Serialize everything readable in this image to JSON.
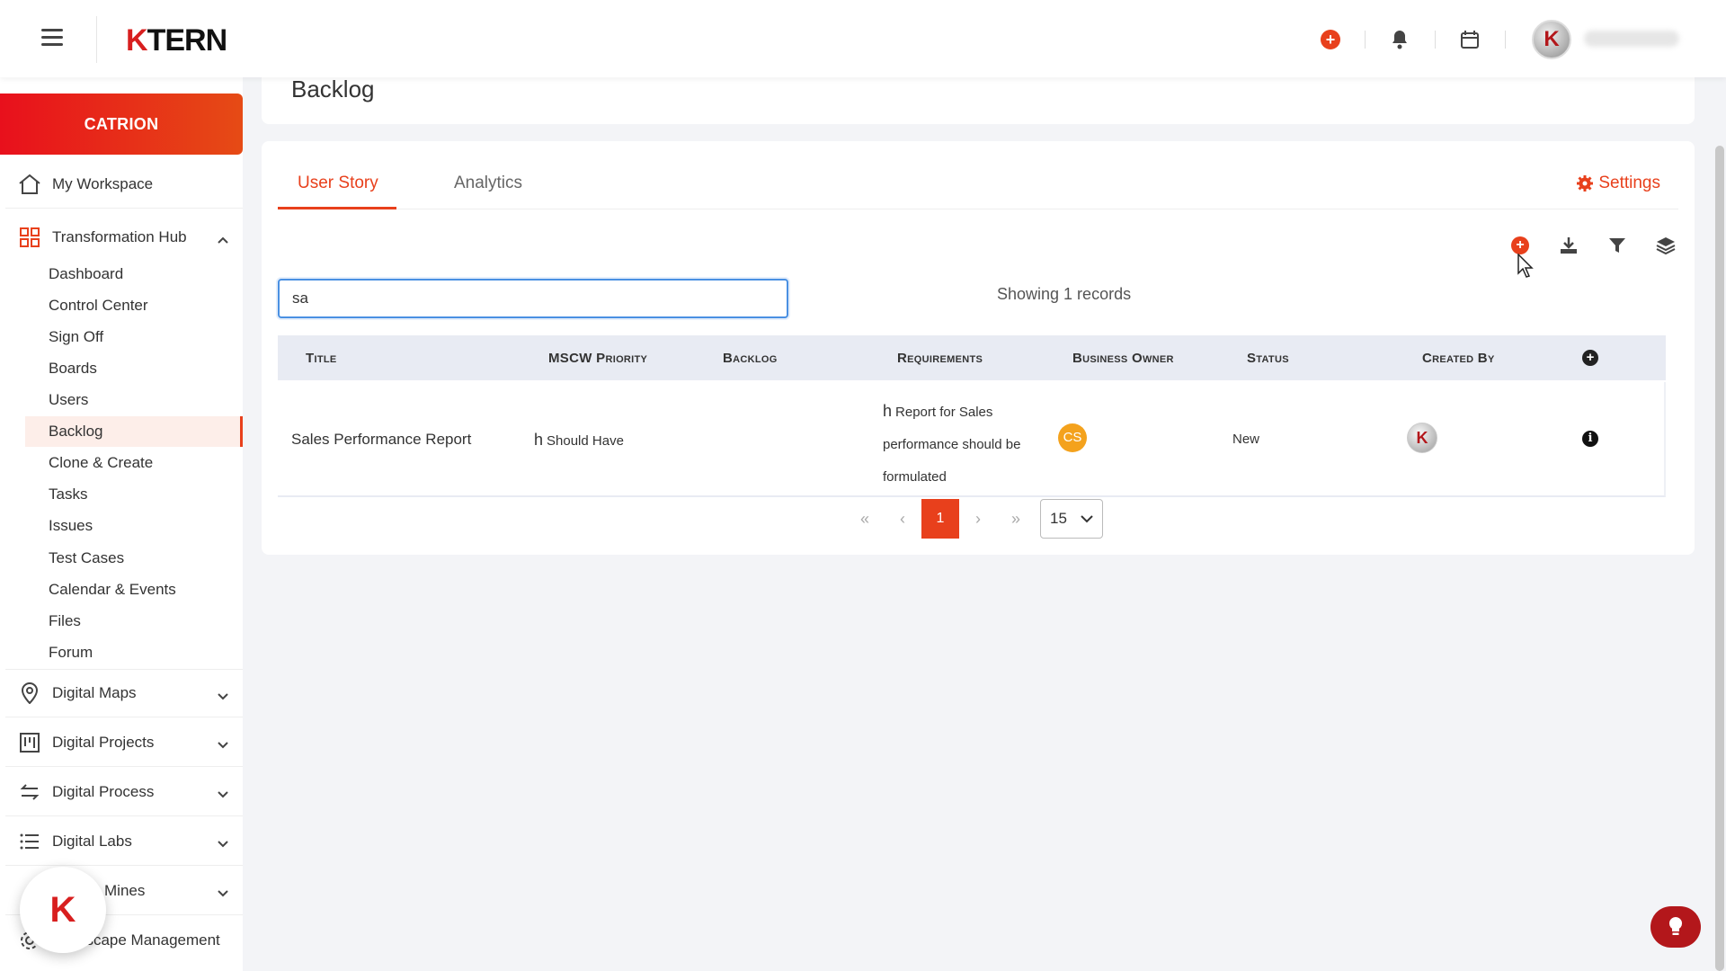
{
  "header": {
    "logo_k": "K",
    "logo_rest": "TERN"
  },
  "sidebar": {
    "org": "CATRION",
    "my_workspace": "My Workspace",
    "transformation_hub": "Transformation Hub",
    "hub_items": [
      "Dashboard",
      "Control Center",
      "Sign Off",
      "Boards",
      "Users",
      "Backlog",
      "Clone & Create",
      "Tasks",
      "Issues",
      "Test Cases",
      "Calendar & Events",
      "Files",
      "Forum"
    ],
    "active_item": "Backlog",
    "sections": [
      "Digital Maps",
      "Digital Projects",
      "Digital Process",
      "Digital Labs",
      "Mines",
      "dscape Management"
    ]
  },
  "page": {
    "title": "Backlog",
    "tabs": [
      "User Story",
      "Analytics"
    ],
    "active_tab": "User Story",
    "settings_label": "Settings",
    "search_value": "sa",
    "showing": "Showing 1 records"
  },
  "table": {
    "columns": [
      "Title",
      "MSCW Priority",
      "Backlog",
      "Requirements",
      "Business Owner",
      "Status",
      "Created By"
    ],
    "rows": [
      {
        "title": "Sales Performance Report",
        "priority_mark": "h",
        "priority": "Should Have",
        "backlog": "",
        "req_mark": "h",
        "req_line1": "Report for Sales",
        "req_line2": "performance should be",
        "req_line3": "formulated",
        "owner_initials": "CS",
        "status": "New",
        "created_by_initial": "K"
      }
    ]
  },
  "pagination": {
    "first": "«",
    "prev": "‹",
    "current": "1",
    "next": "›",
    "last": "»",
    "page_size": "15"
  },
  "fab": {
    "logo": "K"
  },
  "colors": {
    "accent": "#e8401c",
    "brand_red": "#d81f1f",
    "focus_blue": "#4a90e2"
  }
}
